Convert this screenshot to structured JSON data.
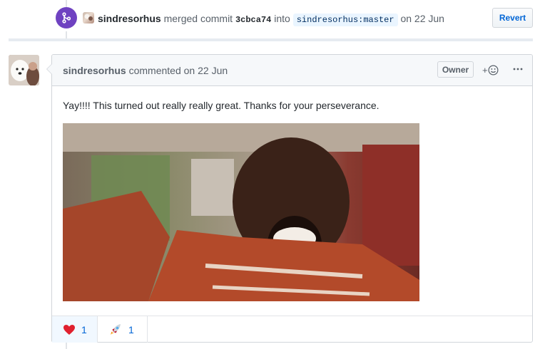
{
  "merge_event": {
    "author": "sindresorhus",
    "action": "merged commit",
    "commit_sha": "3cbca74",
    "into_text": "into",
    "target_branch": "sindresorhus:master",
    "date_text": "on 22 Jun",
    "revert_label": "Revert",
    "icon": "git-merge-icon",
    "badge_color": "#6f42c1"
  },
  "comment": {
    "author": "sindresorhus",
    "action_text": "commented",
    "date_text": "on 22 Jun",
    "role_badge": "Owner",
    "add_reaction_icon": "smiley-icon",
    "more_icon": "kebab-horizontal-icon",
    "body": "Yay!!!! This turned out really really great. Thanks for your perseverance.",
    "media": "animated-gif-celebrating-man"
  },
  "reactions": [
    {
      "emoji": "heart",
      "count": "1",
      "selected": true
    },
    {
      "emoji": "rocket",
      "count": "1",
      "selected": false
    }
  ],
  "colors": {
    "link_blue": "#0366d6",
    "header_bg": "#f6f8fa",
    "border": "#d1d5da",
    "selected_reaction_bg": "#f1f8ff"
  }
}
